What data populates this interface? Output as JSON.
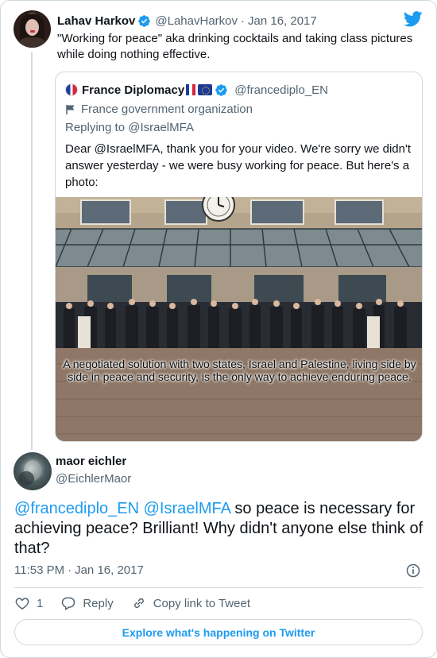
{
  "tweet": {
    "author_name": "Lahav Harkov",
    "author_handle": "@LahavHarkov",
    "separator": "·",
    "date": "Jan 16, 2017",
    "text": "\"Working for peace\" aka drinking cocktails and taking class pictures while doing nothing effective."
  },
  "quoted_tweet": {
    "author_name": "France Diplomacy",
    "author_handle": "@francediplo_EN",
    "org_label": "France government organization",
    "replying_to": "Replying to @IsraelMFA",
    "text": "Dear @IsraelMFA, thank you for your video. We're sorry we didn't answer yesterday - we were busy working for peace. But here's a photo:",
    "photo_caption": "A negotiated solution with two states, Israel and Palestine, living side by side in peace and security, is the only way to achieve enduring peace."
  },
  "reply": {
    "author_name": "maor eichler",
    "author_handle": "@EichlerMaor",
    "mention_1": "@francediplo_EN",
    "mention_2": "@IsraelMFA",
    "text": " so peace is necessary for achieving peace? Brilliant! Why didn't anyone else think of that?",
    "time": "11:53 PM",
    "separator": "·",
    "date": "Jan 16, 2017",
    "like_count": "1",
    "reply_label": "Reply",
    "copy_link_label": "Copy link to Tweet"
  },
  "explore_label": "Explore what's happening on Twitter",
  "colors": {
    "accent": "#1d9bf0",
    "text": "#0f1419",
    "muted": "#536471",
    "border": "#cfd9de"
  },
  "icons": [
    "verified-badge-icon",
    "twitter-bird-icon",
    "government-flag-icon",
    "info-icon",
    "heart-icon",
    "reply-icon",
    "link-icon"
  ]
}
